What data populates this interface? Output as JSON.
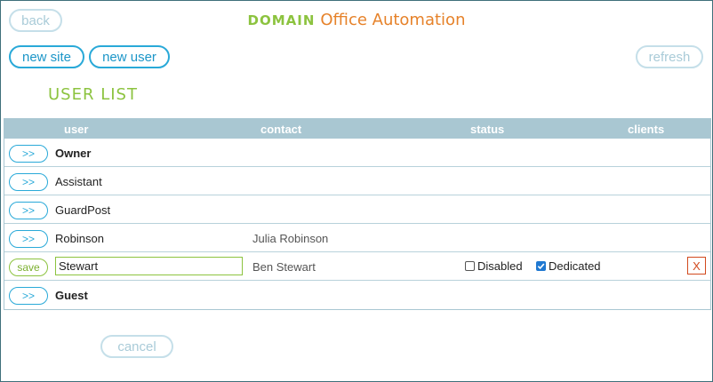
{
  "header": {
    "back_label": "back",
    "domain_label": "DOMAIN",
    "app_name": "Office Automation",
    "refresh_label": "refresh"
  },
  "toolbar": {
    "new_site_label": "new site",
    "new_user_label": "new user"
  },
  "list_title": "USER LIST",
  "table": {
    "columns": [
      "user",
      "contact",
      "status",
      "clients"
    ],
    "rows": [
      {
        "action": ">>",
        "user": "Owner",
        "contact": ""
      },
      {
        "action": ">>",
        "user": "Assistant",
        "contact": ""
      },
      {
        "action": ">>",
        "user": "GuardPost",
        "contact": ""
      },
      {
        "action": ">>",
        "user": "Robinson",
        "contact": "Julia Robinson"
      },
      {
        "action": "save",
        "user": "Stewart",
        "contact": "Ben Stewart",
        "status": {
          "disabled_label": "Disabled",
          "disabled_checked": false,
          "dedicated_label": "Dedicated",
          "dedicated_checked": true
        },
        "delete_label": "X"
      },
      {
        "action": ">>",
        "user": "Guest",
        "contact": ""
      }
    ]
  },
  "footer": {
    "cancel_label": "cancel"
  },
  "colors": {
    "accent_blue": "#29a9d8",
    "accent_green": "#8cc33f",
    "accent_orange": "#e6822a",
    "header_bg": "#a9c7d2",
    "delete_red": "#d24a1e"
  }
}
